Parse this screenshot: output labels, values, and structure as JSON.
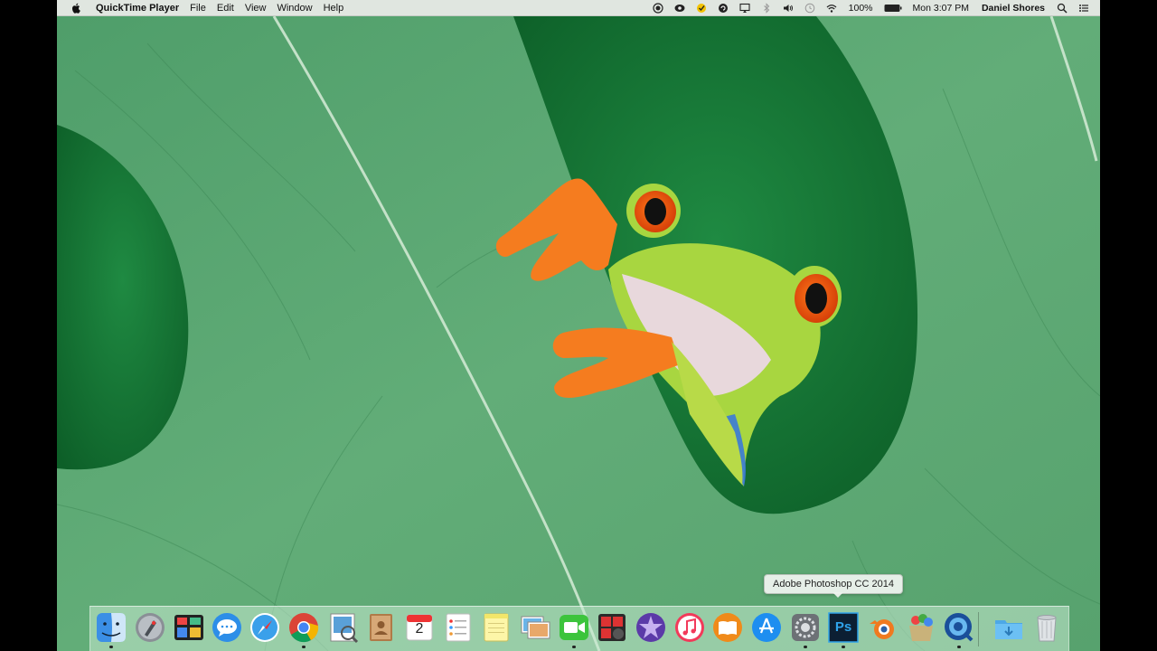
{
  "menubar": {
    "apple_icon": "apple-icon",
    "app_name": "QuickTime Player",
    "menus": [
      "File",
      "Edit",
      "View",
      "Window",
      "Help"
    ],
    "status_icons": [
      "record-icon",
      "eye-icon",
      "norton-icon",
      "sync-icon",
      "airplay-icon",
      "bluetooth-icon",
      "volume-icon",
      "time-machine-icon",
      "wifi-icon"
    ],
    "battery_percent": "100%",
    "battery_icon": "battery-icon",
    "clock": "Mon 3:07 PM",
    "user": "Daniel Shores",
    "spotlight_icon": "spotlight-icon",
    "notification_icon": "notification-center-icon"
  },
  "dock": {
    "tooltip": "Adobe Photoshop CC 2014",
    "apps": [
      "Finder",
      "Launchpad",
      "Mission Control",
      "Messages",
      "Safari",
      "Google Chrome",
      "Preview",
      "Contacts",
      "Calendar",
      "Reminders",
      "Notes",
      "Photo Booth",
      "FaceTime",
      "Photo Gallery",
      "iMovie",
      "iTunes",
      "iBooks",
      "App Store",
      "System Preferences",
      "Adobe Photoshop CC 2014",
      "Blender",
      "Installer",
      "QuickTime Player"
    ],
    "calendar_day": "2",
    "photoshop_label": "Ps",
    "downloads": "Downloads",
    "trash": "Trash"
  },
  "colors": {
    "leaf": "#5ba873",
    "gap": "#1a7a3a",
    "frog_green": "#9fd23a",
    "frog_orange": "#f47a1a"
  }
}
